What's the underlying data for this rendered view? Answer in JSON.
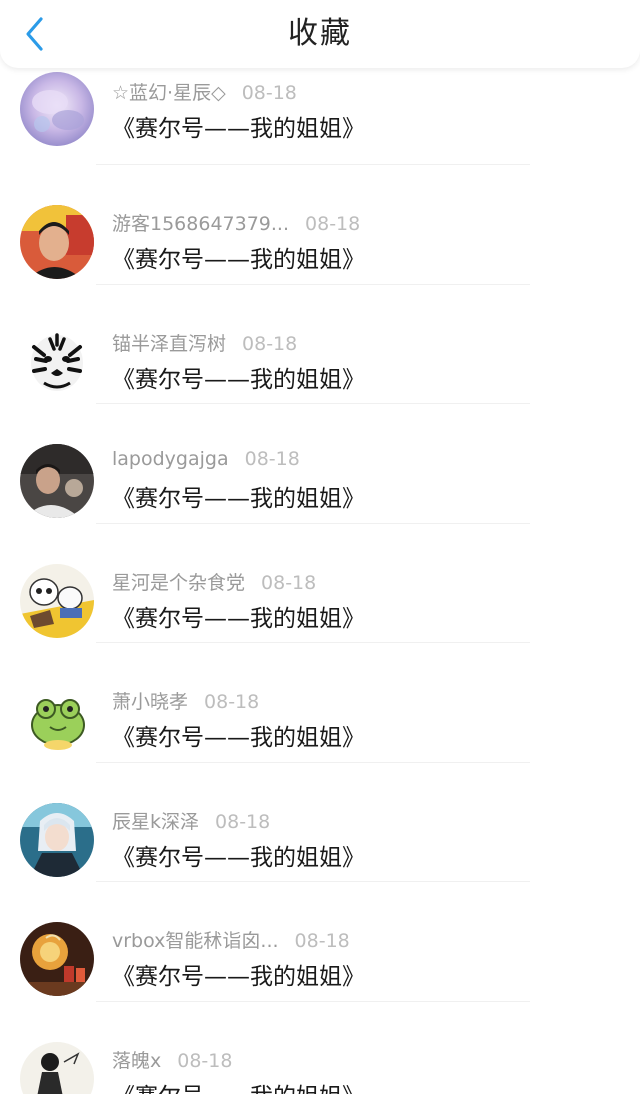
{
  "header": {
    "title": "收藏"
  },
  "colors": {
    "accent": "#2b9be8",
    "text": "#1a1a1a",
    "meta": "#9a9a9a",
    "date": "#bdbdbd"
  },
  "favorites": [
    {
      "user": "☆蓝幻·星辰◇",
      "date": "08-18",
      "book": "《赛尔号——我的姐姐》",
      "avatar": "watercolor-avatar"
    },
    {
      "user": "游客1568647379...",
      "date": "08-18",
      "book": "《赛尔号——我的姐姐》",
      "avatar": "photo-avatar"
    },
    {
      "user": "锚半泽直泻树",
      "date": "08-18",
      "book": "《赛尔号——我的姐姐》",
      "avatar": "tiger-avatar"
    },
    {
      "user": "lapodygajga",
      "date": "08-18",
      "book": "《赛尔号——我的姐姐》",
      "avatar": "photo-avatar"
    },
    {
      "user": "星河是个杂食党",
      "date": "08-18",
      "book": "《赛尔号——我的姐姐》",
      "avatar": "cartoon-avatar"
    },
    {
      "user": "萧小晓孝",
      "date": "08-18",
      "book": "《赛尔号——我的姐姐》",
      "avatar": "frog-avatar"
    },
    {
      "user": "辰星k深泽",
      "date": "08-18",
      "book": "《赛尔号——我的姐姐》",
      "avatar": "anime-avatar"
    },
    {
      "user": "vrbox智能秫诣囟...",
      "date": "08-18",
      "book": "《赛尔号——我的姐姐》",
      "avatar": "lamp-avatar"
    },
    {
      "user": "落魄x",
      "date": "08-18",
      "book": "《赛尔号——我的姐姐》",
      "avatar": "sketch-avatar"
    }
  ]
}
